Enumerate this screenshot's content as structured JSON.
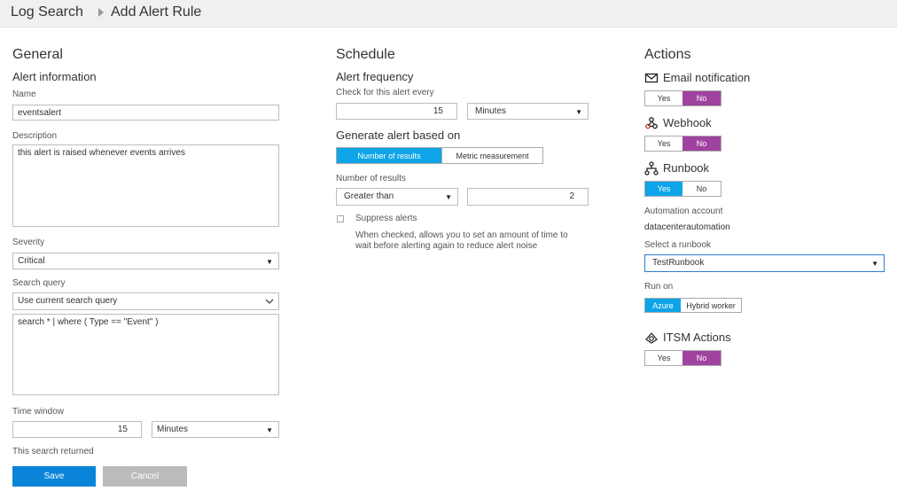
{
  "breadcrumb": {
    "parent": "Log Search",
    "current": "Add Alert Rule"
  },
  "general": {
    "title": "General",
    "section": "Alert information",
    "name_label": "Name",
    "name_value": "eventsalert",
    "description_label": "Description",
    "description_value": "this alert is raised whenever events arrives",
    "severity_label": "Severity",
    "severity_value": "Critical",
    "search_query_label": "Search query",
    "search_query_option": "Use current search query",
    "search_query_text": "search * | where ( Type == \"Event\" )",
    "time_window_label": "Time window",
    "time_window_value": "15",
    "time_window_unit": "Minutes",
    "search_returned": "This search returned",
    "save_label": "Save",
    "cancel_label": "Cancel"
  },
  "schedule": {
    "title": "Schedule",
    "alert_frequency": "Alert frequency",
    "check_label": "Check for this alert every",
    "frequency_value": "15",
    "frequency_unit": "Minutes",
    "generate_label": "Generate alert based on",
    "tab_number": "Number of results",
    "tab_metric": "Metric measurement",
    "number_results_label": "Number of results",
    "operator_value": "Greater than",
    "threshold_value": "2",
    "suppress_label": "Suppress alerts",
    "suppress_help_1": "When checked, allows you to set an amount of time to",
    "suppress_help_2": "wait before alerting again to reduce alert noise"
  },
  "actions": {
    "title": "Actions",
    "email_label": "Email notification",
    "webhook_label": "Webhook",
    "runbook_label": "Runbook",
    "itsm_label": "ITSM Actions",
    "yes": "Yes",
    "no": "No",
    "automation_label": "Automation account",
    "automation_value": "datacenterautomation",
    "select_runbook_label": "Select a runbook",
    "runbook_value": "TestRunbook",
    "run_on_label": "Run on",
    "run_on_azure": "Azure",
    "run_on_hybrid": "Hybrid worker"
  },
  "colors": {
    "purple": "#a043a0",
    "blue": "#0ea5e8",
    "save": "#0a84d8"
  }
}
